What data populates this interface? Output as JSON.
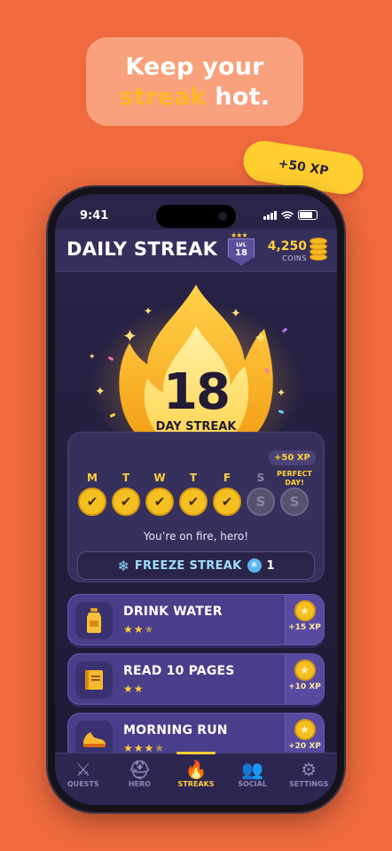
{
  "promo": {
    "line1": "Keep your",
    "highlight": "streak",
    "rest": " hot.",
    "xp_tag": "+50 XP"
  },
  "status": {
    "time": "9:41"
  },
  "header": {
    "title": "DAILY STREAK",
    "level_label": "LVL",
    "level": "18",
    "coins": "4,250",
    "coins_label": "COINS"
  },
  "streak": {
    "days": "18",
    "label": "DAY STREAK"
  },
  "week": {
    "days": [
      {
        "letter": "M",
        "done": true
      },
      {
        "letter": "T",
        "done": true
      },
      {
        "letter": "W",
        "done": true
      },
      {
        "letter": "T",
        "done": true
      },
      {
        "letter": "F",
        "done": true
      },
      {
        "letter": "S",
        "done": false
      },
      {
        "letter": "S",
        "done": false
      }
    ],
    "bonus_xp": "+50 XP",
    "bonus_label": "PERFECT DAY!",
    "message": "You’re on fire, hero!",
    "freeze_label": "FREEZE STREAK",
    "freeze_count": "1"
  },
  "quests": [
    {
      "title": "DRINK WATER",
      "icon": "water-bottle-icon",
      "stars": 2.5,
      "reward": "+15 XP"
    },
    {
      "title": "READ 10 PAGES",
      "icon": "book-icon",
      "stars": 2,
      "reward": "+10 XP"
    },
    {
      "title": "MORNING RUN",
      "icon": "shoe-icon",
      "stars": 3.5,
      "reward": "+20 XP"
    }
  ],
  "tabs": [
    {
      "label": "QUESTS",
      "icon": "sword-icon",
      "active": false
    },
    {
      "label": "HERO",
      "icon": "helmet-icon",
      "active": false
    },
    {
      "label": "STREAKS",
      "icon": "flame-icon",
      "active": true
    },
    {
      "label": "SOCIAL",
      "icon": "people-icon",
      "active": false
    },
    {
      "label": "SETTINGS",
      "icon": "gear-icon",
      "active": false
    }
  ],
  "colors": {
    "background": "#ef6a3e",
    "accent": "#ffcf3a",
    "panel": "#2a2548"
  }
}
